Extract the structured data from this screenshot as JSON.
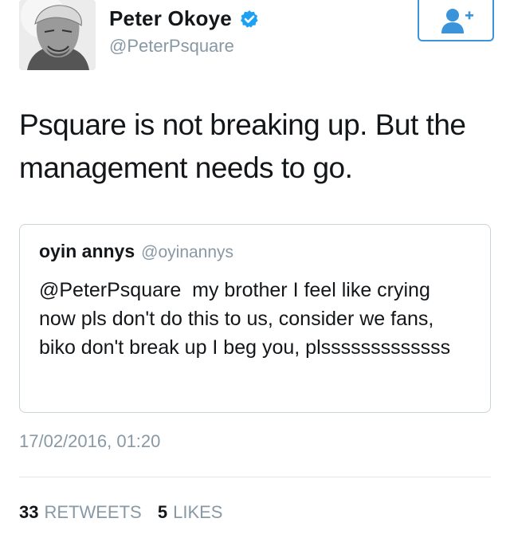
{
  "colors": {
    "accent": "#3b94d9",
    "verified": "#1da1f2",
    "text": "#14171a",
    "muted": "#8899a6",
    "border": "#c9d3da"
  },
  "author": {
    "display_name": "Peter Okoye",
    "handle": "@PeterPsquare",
    "verified": true,
    "avatar_icon": "profile-photo"
  },
  "follow_button": {
    "icon": "follow-user-plus-icon"
  },
  "tweet": {
    "text": "Psquare is not breaking up. But the management needs to go.",
    "timestamp": "17/02/2016, 01:20"
  },
  "quoted_tweet": {
    "display_name": "oyin annys",
    "handle": "@oyinannys",
    "text": "@PeterPsquare  my brother I feel like crying now pls don't do this to us, consider we fans, biko don't break up I beg you, plsssssssssssss"
  },
  "stats": {
    "retweets_count": "33",
    "retweets_label": "RETWEETS",
    "likes_count": "5",
    "likes_label": "LIKES"
  }
}
